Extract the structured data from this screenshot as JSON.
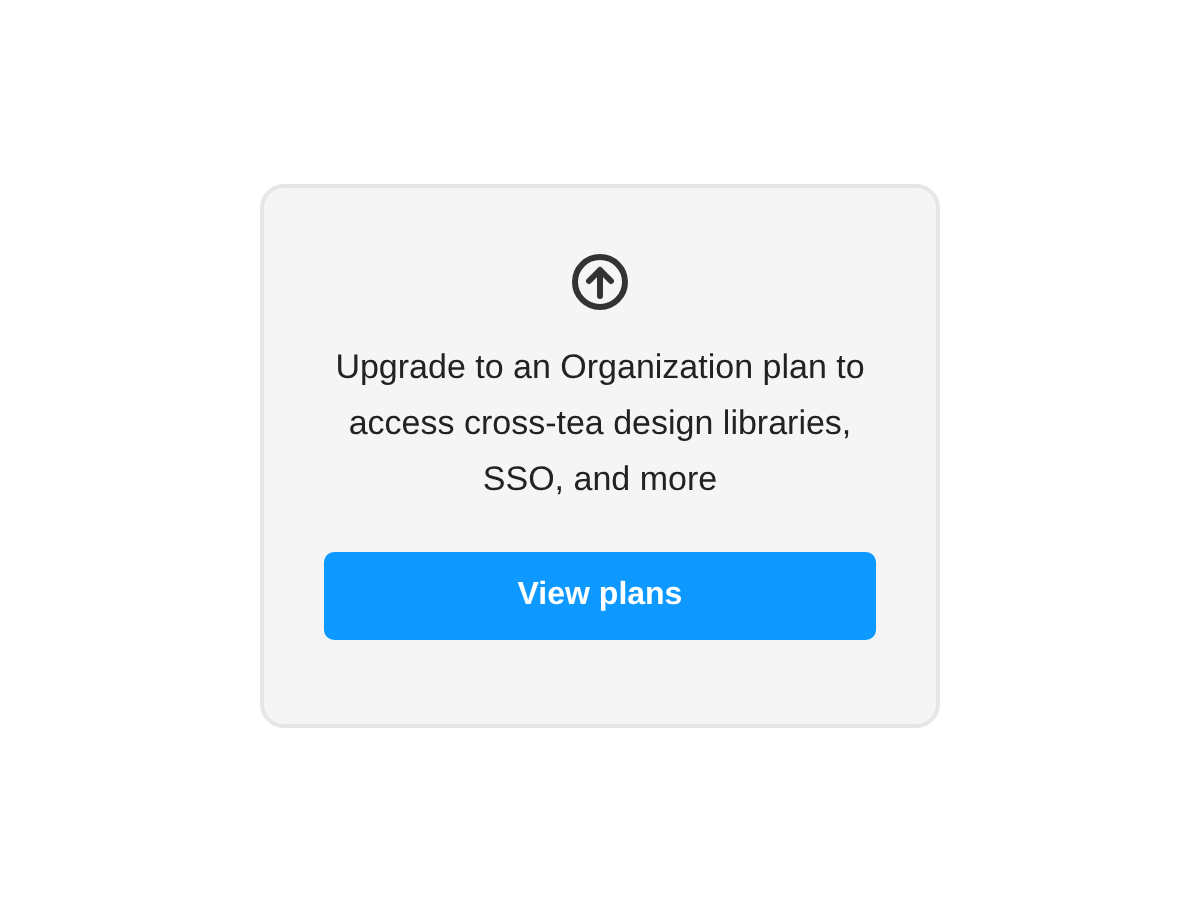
{
  "card": {
    "message": "Upgrade to an Organization plan to access cross-tea design libraries, SSO, and more",
    "button": "View plans"
  }
}
